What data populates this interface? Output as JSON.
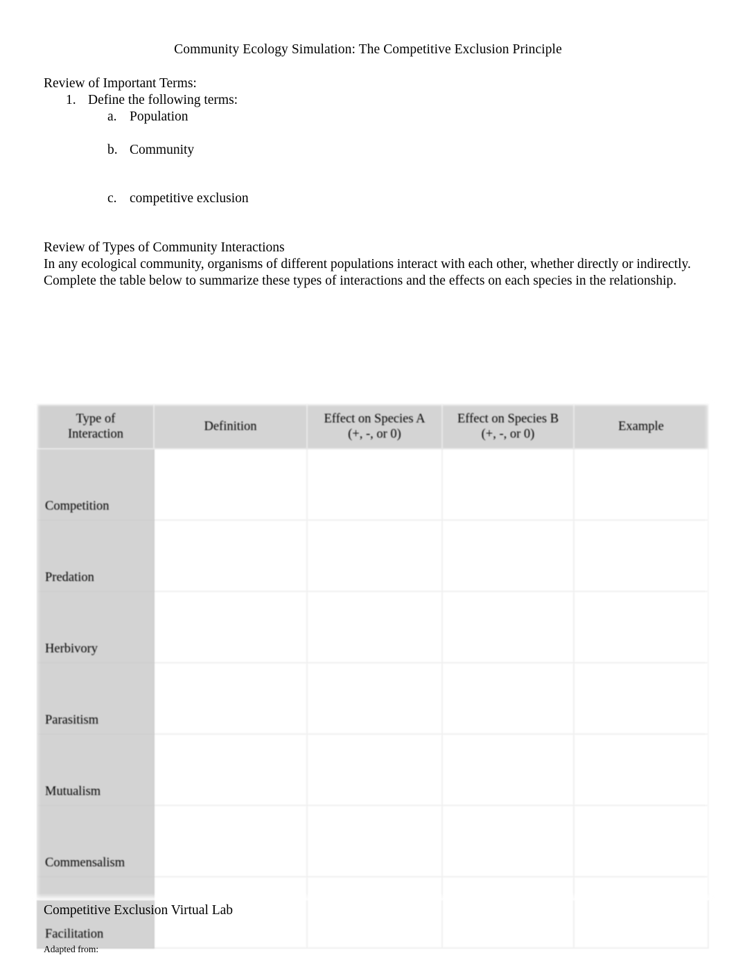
{
  "document": {
    "title": "Community Ecology Simulation: The Competitive Exclusion Principle",
    "section1_heading": "Review of Important Terms:",
    "item1_marker": "1.",
    "item1_text": "Define the following terms:",
    "item1a_marker": "a.",
    "item1a_text": "Population",
    "item1b_marker": "b.",
    "item1b_text": "Community",
    "item1c_marker": "c.",
    "item1c_text": "competitive exclusion",
    "section2_heading": "Review of Types of Community Interactions",
    "section2_line1": "In any ecological community, organisms of different populations interact with each other, whether directly or indirectly.",
    "section2_line2": "Complete the table below to summarize these types of interactions and the effects on each species in the relationship.",
    "section3_heading": "Competitive Exclusion Virtual Lab",
    "footer_note": "Adapted from:"
  },
  "table": {
    "headers": [
      "Type of\nInteraction",
      "Definition",
      "Effect on Species A\n(+, -, or 0)",
      "Effect on Species B\n(+, -, or 0)",
      "Example"
    ],
    "header_lines": [
      [
        "Type of",
        "Interaction"
      ],
      [
        "Definition",
        ""
      ],
      [
        "Effect on Species A",
        "(+, -, or 0)"
      ],
      [
        "Effect on Species B",
        "(+, -, or 0)"
      ],
      [
        "Example",
        ""
      ]
    ],
    "rows": [
      {
        "label": "Competition",
        "definition": "",
        "effect_a": "",
        "effect_b": "",
        "example": ""
      },
      {
        "label": "Predation",
        "definition": "",
        "effect_a": "",
        "effect_b": "",
        "example": ""
      },
      {
        "label": "Herbivory",
        "definition": "",
        "effect_a": "",
        "effect_b": "",
        "example": ""
      },
      {
        "label": "Parasitism",
        "definition": "",
        "effect_a": "",
        "effect_b": "",
        "example": ""
      },
      {
        "label": "Mutualism",
        "definition": "",
        "effect_a": "",
        "effect_b": "",
        "example": ""
      },
      {
        "label": "Commensalism",
        "definition": "",
        "effect_a": "",
        "effect_b": "",
        "example": ""
      },
      {
        "label": "Facilitation",
        "definition": "",
        "effect_a": "",
        "effect_b": "",
        "example": ""
      }
    ],
    "colors": {
      "header_bg": "#d4d4d4",
      "label_column_bg": "#d3d3d3",
      "cell_bg": "#ffffff",
      "gridline": "#f0f0f0",
      "text": "#000000"
    }
  }
}
